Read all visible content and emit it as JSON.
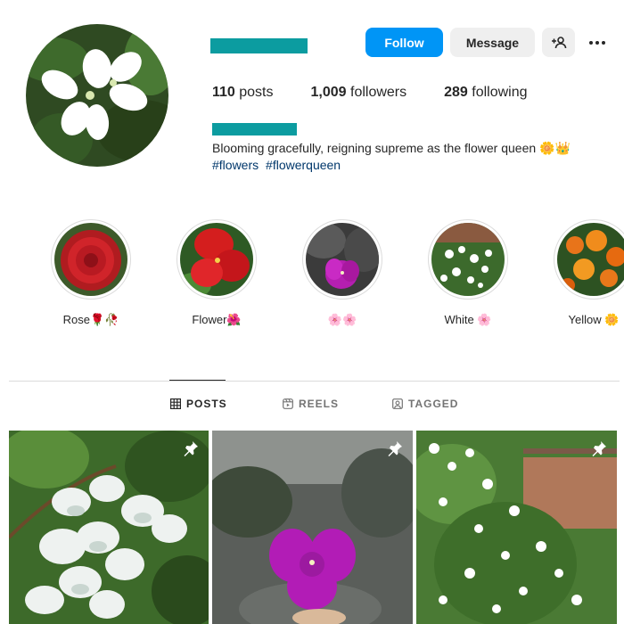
{
  "profile": {
    "follow_label": "Follow",
    "message_label": "Message",
    "posts_count": "110",
    "posts_label": " posts",
    "followers_count": "1,009",
    "followers_label": " followers",
    "following_count": "289",
    "following_label": " following",
    "bio": "Blooming gracefully, reigning supreme as the flower queen 🌼👑",
    "hashtags": [
      "#flowers",
      "#flowerqueen"
    ]
  },
  "colors": {
    "primary": "#0095f6",
    "redaction": "#0c9ca0",
    "hashtag": "#00376b"
  },
  "highlights": [
    {
      "label": "Rose🌹🥀",
      "icon": "red-dahlia"
    },
    {
      "label": "Flower🌺",
      "icon": "red-hibiscus"
    },
    {
      "label": "🌸🌸",
      "icon": "purple-bougainvillea"
    },
    {
      "label": "White 🌸",
      "icon": "white-jasmine"
    },
    {
      "label": "Yellow 🌼",
      "icon": "orange-marigold"
    }
  ],
  "tabs": [
    {
      "label": "POSTS",
      "icon": "grid-icon",
      "active": true
    },
    {
      "label": "REELS",
      "icon": "reels-icon",
      "active": false
    },
    {
      "label": "TAGGED",
      "icon": "tagged-icon",
      "active": false
    }
  ],
  "posts": [
    {
      "subject": "white-bougainvillea",
      "pinned": true
    },
    {
      "subject": "purple-bougainvillea",
      "pinned": true
    },
    {
      "subject": "white-jasmine",
      "pinned": true
    }
  ]
}
